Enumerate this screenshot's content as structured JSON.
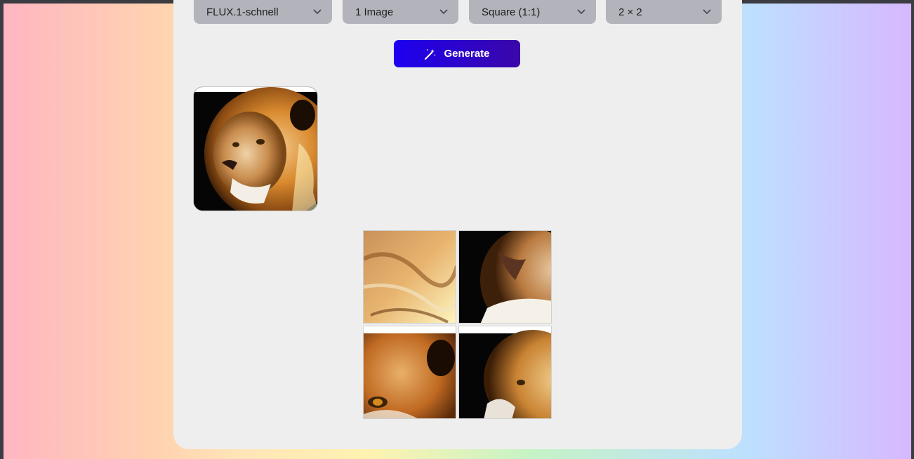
{
  "controls": {
    "model": {
      "value": "FLUX.1-schnell",
      "icon": "chevron-down-icon"
    },
    "count": {
      "value": "1 Image",
      "icon": "chevron-down-icon"
    },
    "aspect": {
      "value": "Square (1:1)",
      "icon": "chevron-down-icon"
    },
    "grid": {
      "value": "2 × 2",
      "icon": "chevron-down-icon"
    }
  },
  "generate": {
    "label": "Generate",
    "icon": "magic-wand-icon"
  },
  "gallery": {
    "thumbnail": {
      "subject": "lion portrait"
    },
    "tiles": [
      {
        "subject": "lion mane close-up"
      },
      {
        "subject": "lion muzzle close-up"
      },
      {
        "subject": "lion eye and ear close-up"
      },
      {
        "subject": "lion side profile"
      }
    ]
  },
  "colors": {
    "accent": "#1d00f0",
    "card": "#eeeeee",
    "dropdown": "#b3b3bb"
  }
}
